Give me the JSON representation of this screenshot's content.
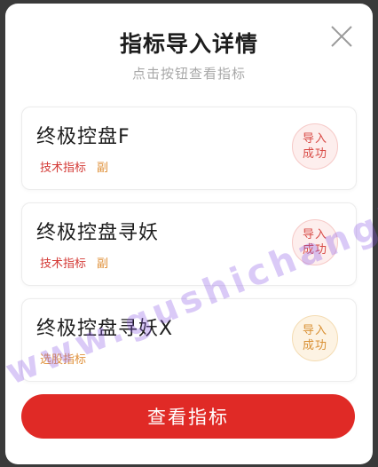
{
  "dialog": {
    "title": "指标导入详情",
    "subtitle": "点击按钮查看指标"
  },
  "items": [
    {
      "name": "终极控盘F",
      "tags": [
        "技术指标",
        "副"
      ],
      "status_line1": "导入",
      "status_line2": "成功"
    },
    {
      "name": "终极控盘寻妖",
      "tags": [
        "技术指标",
        "副"
      ],
      "status_line1": "导入",
      "status_line2": "成功"
    },
    {
      "name": "终极控盘寻妖X",
      "tags": [
        "选股指标"
      ],
      "status_line1": "导入",
      "status_line2": "成功"
    }
  ],
  "button": {
    "label": "查看指标"
  },
  "watermark": "www.gushichanghong.com",
  "colors": {
    "accent": "#e02a26",
    "tag_red": "#d43a36",
    "tag_orange": "#e0913a",
    "status_red": "#d84a45",
    "status_orange": "#d99033"
  }
}
